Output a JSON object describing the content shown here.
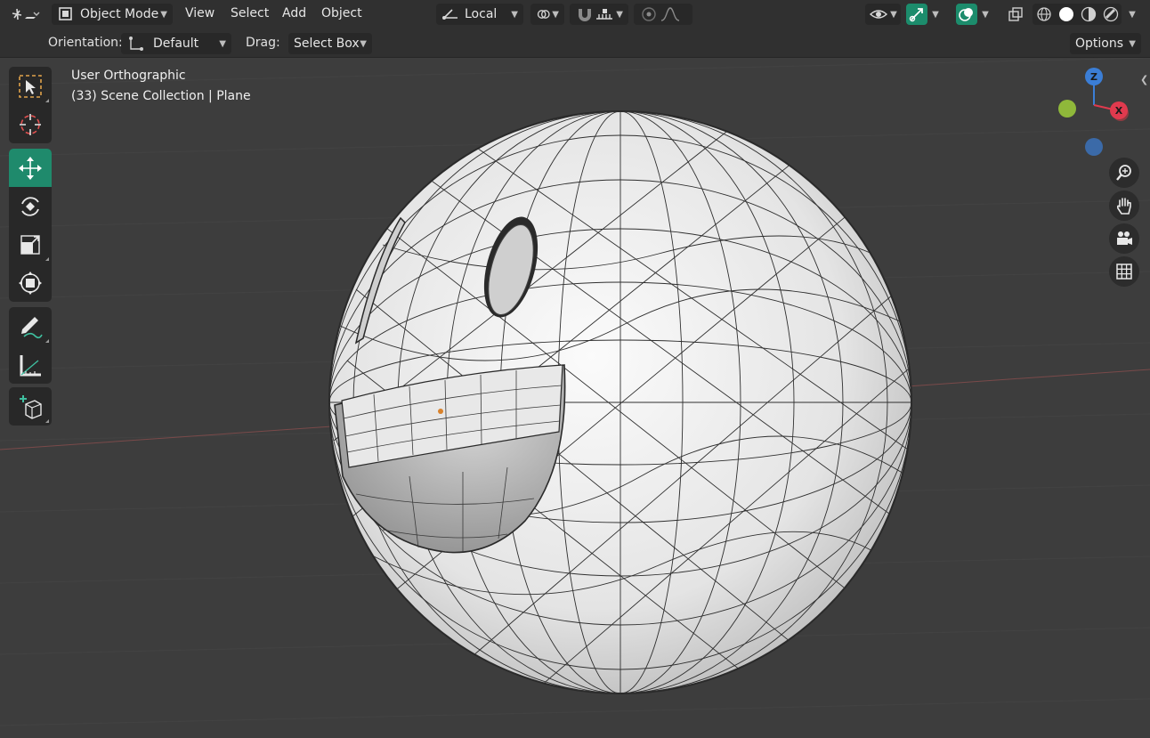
{
  "header": {
    "mode_label": "Object Mode",
    "menus": [
      "View",
      "Select",
      "Add",
      "Object"
    ],
    "transform_orientation": "Local"
  },
  "tool_settings": {
    "orientation_label": "Orientation:",
    "orientation_value": "Default",
    "drag_label": "Drag:",
    "drag_value": "Select Box",
    "options_label": "Options"
  },
  "viewport": {
    "view_name": "User Orthographic",
    "collection_info": "(33) Scene Collection | Plane"
  },
  "gizmo": {
    "z_label": "Z",
    "x_label": "X",
    "colors": {
      "z": "#3b7ed6",
      "x": "#e03a4e",
      "y": "#8fb83a"
    }
  },
  "icons": {
    "toolbar": [
      "select-box-icon",
      "cursor-icon",
      "move-icon",
      "rotate-icon",
      "scale-icon",
      "transform-icon",
      "annotate-icon",
      "measure-icon",
      "add-cube-icon"
    ],
    "nav": [
      "zoom-icon",
      "pan-hand-icon",
      "camera-icon",
      "grid-icon"
    ]
  },
  "colors": {
    "accent": "#1f8a6c",
    "header_bg": "#303030",
    "viewport_bg": "#3d3d3d"
  }
}
